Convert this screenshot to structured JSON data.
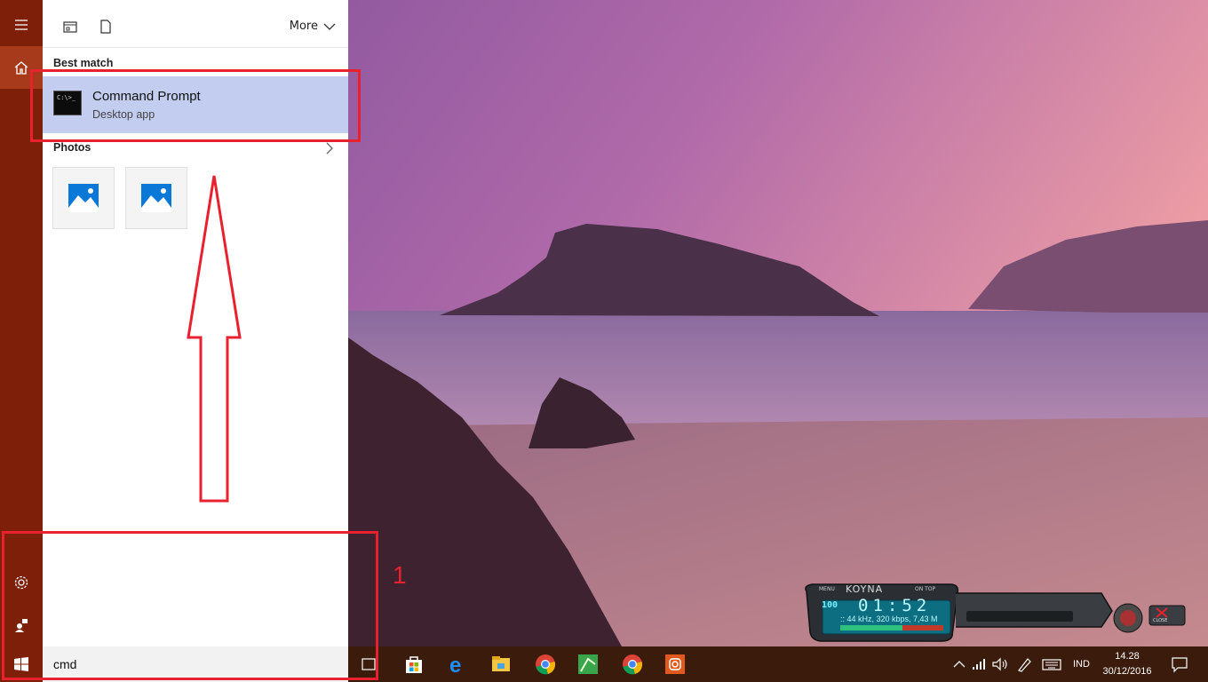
{
  "start_menu": {
    "more_label": "More",
    "best_match": {
      "section_title": "Best match",
      "title": "Command Prompt",
      "subtitle": "Desktop app",
      "icon_text": "C:\\>_"
    },
    "photos": {
      "section_title": "Photos",
      "count": 2
    }
  },
  "search": {
    "value": "cmd"
  },
  "taskbar": {
    "pinned": [
      "task-view-icon",
      "store-icon",
      "edge-icon",
      "file-explorer-icon",
      "chrome-icon",
      "greenshot-icon",
      "chrome-icon",
      "instagram-icon"
    ],
    "tray": {
      "language": "IND",
      "time": "14.28",
      "date": "30/12/2016"
    }
  },
  "annotation": {
    "number": "1",
    "color": "#e8212e"
  },
  "koyna_player": {
    "title": "KOYNA",
    "menu_label": "MENU",
    "ontop_label": "ON TOP",
    "volume": "100",
    "time": "01:52",
    "info": ":: 44 kHz, 320 kbps, 7,43 M",
    "close_label": "CLOSE"
  },
  "colors": {
    "rail": "#7e1f0a",
    "taskbar": "#3a1b0c",
    "selection": "#c2cdf0",
    "annotation": "#e8212e"
  }
}
